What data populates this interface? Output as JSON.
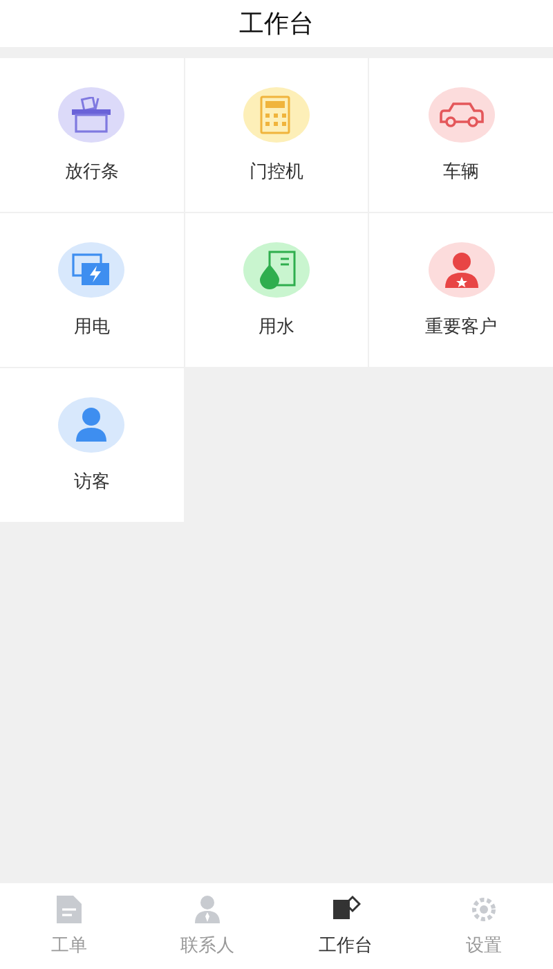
{
  "header": {
    "title": "工作台"
  },
  "modules": [
    {
      "label": "放行条",
      "kind": "basket"
    },
    {
      "label": "门控机",
      "kind": "calculator"
    },
    {
      "label": "车辆",
      "kind": "car"
    },
    {
      "label": "用电",
      "kind": "power"
    },
    {
      "label": "用水",
      "kind": "water"
    },
    {
      "label": "重要客户",
      "kind": "vip"
    },
    {
      "label": "访客",
      "kind": "visitor"
    }
  ],
  "tab_bar": [
    {
      "label": "工单",
      "kind": "document",
      "selected": false
    },
    {
      "label": "联系人",
      "kind": "contact",
      "selected": false
    },
    {
      "label": "工作台",
      "kind": "desk",
      "selected": true
    },
    {
      "label": "设置",
      "kind": "gear",
      "selected": false
    }
  ]
}
